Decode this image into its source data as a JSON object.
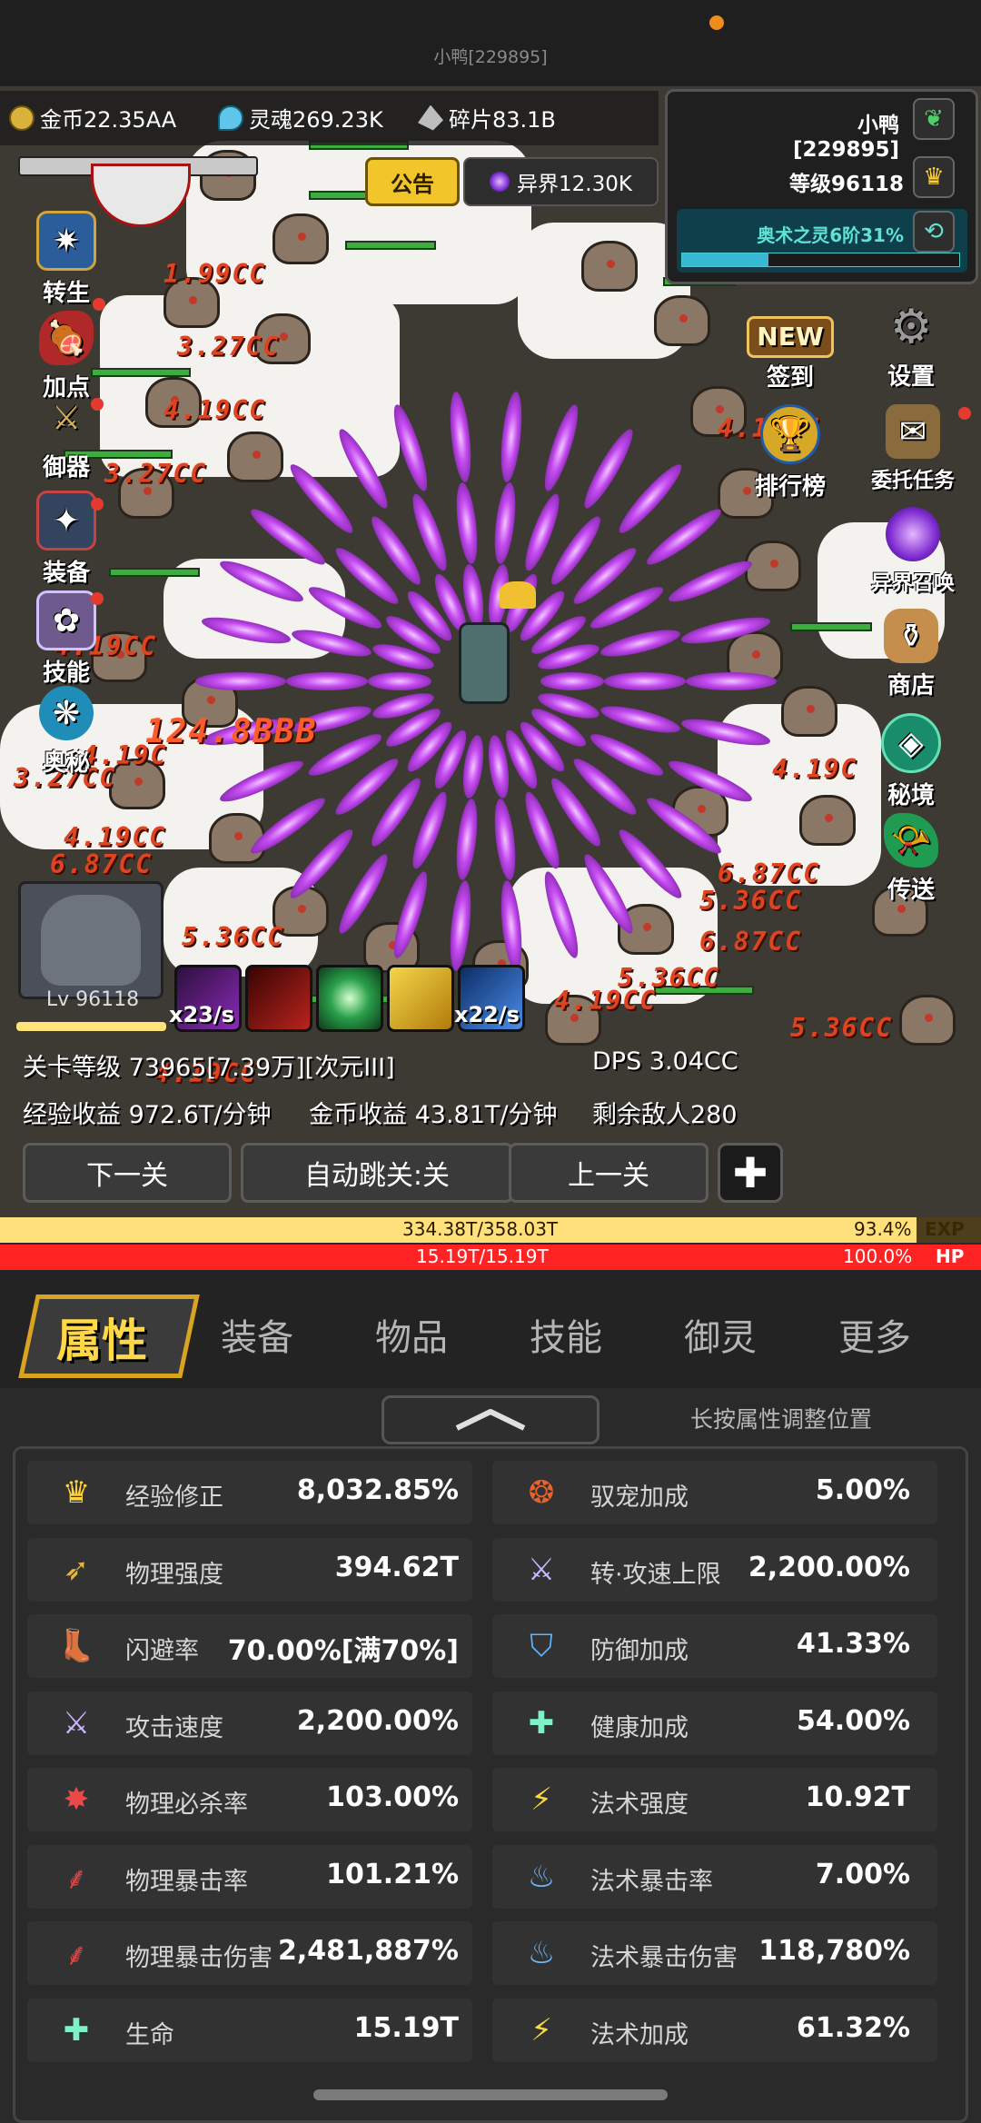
{
  "top": {
    "user_label": "小鸭[229895]"
  },
  "resources": {
    "gold": "金币22.35AA",
    "soul": "灵魂269.23K",
    "shard": "碎片83.1B",
    "otherworld": "异界12.30K"
  },
  "notice_label": "公告",
  "player": {
    "name": "小鸭[229895]",
    "level": "等级96118",
    "rune": "奥术之灵6阶31%",
    "rune_progress": 0.31
  },
  "left_menu": [
    {
      "label": "转生",
      "icon": "rebirth-icon"
    },
    {
      "label": "加点",
      "icon": "meat-icon"
    },
    {
      "label": "御器",
      "icon": "sword-icon"
    },
    {
      "label": "装备",
      "icon": "armor-icon"
    },
    {
      "label": "技能",
      "icon": "skillbook-icon"
    },
    {
      "label": "奥秘",
      "icon": "arcane-icon"
    }
  ],
  "right_menu": [
    {
      "label": "签到",
      "icon": "new-badge-icon"
    },
    {
      "label": "设置",
      "icon": "gear-icon"
    },
    {
      "label": "排行榜",
      "icon": "trophy-icon"
    },
    {
      "label": "委托任务",
      "icon": "scroll-icon"
    },
    {
      "label": "异界召唤",
      "icon": "portal-icon"
    },
    {
      "label": "商店",
      "icon": "bag-icon"
    },
    {
      "label": "秘境",
      "icon": "crystal-icon"
    },
    {
      "label": "传送",
      "icon": "horn-icon"
    }
  ],
  "new_badge": "NEW",
  "damage_numbers": [
    "1.99CC",
    "3.27CC",
    "4.19CC",
    "3.27CC",
    "4.19CC",
    "124.8BBB",
    "4.19C",
    "3.27CC",
    "4.19CC",
    "6.87CC",
    "5.36CC",
    "4.19C",
    "6.87CC",
    "5.36CC",
    "6.87CC",
    "4.19CC",
    "5.36CC",
    "4.19CC",
    "5.36CC",
    "4.19CC"
  ],
  "hero": {
    "level": "Lv 96118"
  },
  "skills": {
    "rate_left": "x23/s",
    "rate_right": "x22/s"
  },
  "stage_info": {
    "stage": "关卡等级 73965[7.39万][次元III]",
    "dps": "DPS 3.04CC",
    "exp_rate": "经验收益 972.6T/分钟",
    "gold_rate": "金币收益 43.81T/分钟",
    "enemies_left": "剩余敌人280"
  },
  "nav": {
    "next": "下一关",
    "auto": "自动跳关:关",
    "prev": "上一关"
  },
  "exp_bar": {
    "value": "334.38T/358.03T",
    "percent": "93.4%",
    "label": "EXP",
    "fraction": 0.934
  },
  "hp_bar": {
    "value": "15.19T/15.19T",
    "percent": "100.0%",
    "label": "HP",
    "fraction": 1.0
  },
  "tabs": [
    "属性",
    "装备",
    "物品",
    "技能",
    "御灵",
    "更多"
  ],
  "hint": "长按属性调整位置",
  "stats_left": [
    {
      "name": "经验修正",
      "value": "8,032.85%",
      "icon": "crown-icon"
    },
    {
      "name": "物理强度",
      "value": "394.62T",
      "icon": "blade-icon"
    },
    {
      "name": "闪避率",
      "value": "70.00%[满70%]",
      "icon": "boot-icon"
    },
    {
      "name": "攻击速度",
      "value": "2,200.00%",
      "icon": "crossed-swords-icon"
    },
    {
      "name": "物理必杀率",
      "value": "103.00%",
      "icon": "slash-icon"
    },
    {
      "name": "物理暴击率",
      "value": "101.21%",
      "icon": "claw-icon"
    },
    {
      "name": "物理暴击伤害",
      "value": "2,481,887%",
      "icon": "claw-icon"
    },
    {
      "name": "生命",
      "value": "15.19T",
      "icon": "heal-cross-icon"
    }
  ],
  "stats_right": [
    {
      "name": "驭宠加成",
      "value": "5.00%",
      "icon": "pet-icon"
    },
    {
      "name": "转·攻速上限",
      "value": "2,200.00%",
      "icon": "crossed-swords-icon"
    },
    {
      "name": "防御加成",
      "value": "41.33%",
      "icon": "shield-icon"
    },
    {
      "name": "健康加成",
      "value": "54.00%",
      "icon": "heal-cross-icon"
    },
    {
      "name": "法术强度",
      "value": "10.92T",
      "icon": "lightning-icon"
    },
    {
      "name": "法术暴击率",
      "value": "7.00%",
      "icon": "blue-flame-icon"
    },
    {
      "name": "法术暴击伤害",
      "value": "118,780%",
      "icon": "blue-flame-icon"
    },
    {
      "name": "法术加成",
      "value": "61.32%",
      "icon": "lightning-icon"
    }
  ]
}
